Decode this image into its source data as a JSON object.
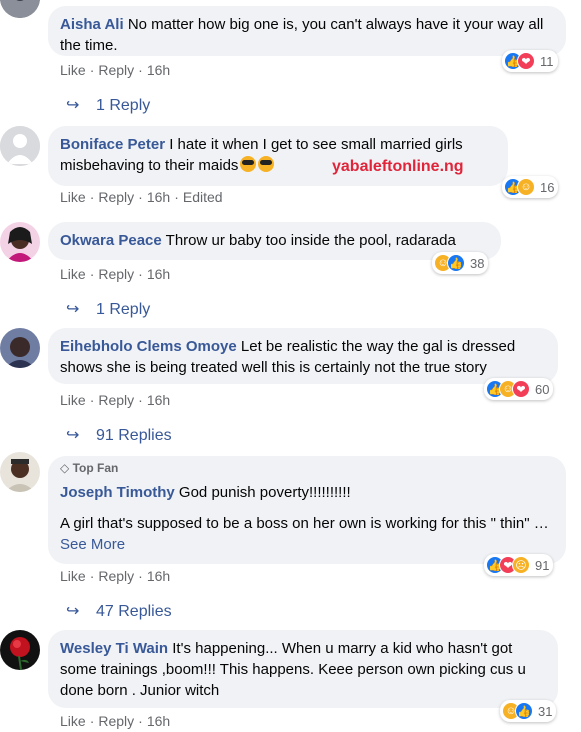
{
  "watermark": "yabaleftonline.ng",
  "comments": [
    {
      "author": "Aisha Ali",
      "text": "No matter how big one is, you can't always have it your way all the time.",
      "actions": {
        "like": "Like",
        "reply": "Reply",
        "time": "16h"
      },
      "reaction_count": "11",
      "reaction_types": [
        "like",
        "love"
      ],
      "replies": "1 Reply"
    },
    {
      "author": "Boniface Peter",
      "text": "I hate it when I get to see small married girls misbehaving to their maids",
      "emoji": [
        "sunglasses-emoji",
        "sunglasses-emoji"
      ],
      "actions": {
        "like": "Like",
        "reply": "Reply",
        "time": "16h",
        "edited": "Edited"
      },
      "reaction_count": "16",
      "reaction_types": [
        "like",
        "haha"
      ]
    },
    {
      "author": "Okwara Peace",
      "text": "Throw ur baby too inside the pool, radarada",
      "actions": {
        "like": "Like",
        "reply": "Reply",
        "time": "16h"
      },
      "reaction_count": "38",
      "reaction_types": [
        "haha",
        "like"
      ],
      "replies": "1 Reply"
    },
    {
      "author": "Eihebholo Clems Omoye",
      "text": "Let be realistic the way the gal is dressed shows she is being treated well this is certainly not the true story",
      "actions": {
        "like": "Like",
        "reply": "Reply",
        "time": "16h"
      },
      "reaction_count": "60",
      "reaction_types": [
        "like",
        "haha",
        "love"
      ],
      "replies": "91 Replies"
    },
    {
      "badge": "Top Fan",
      "author": "Joseph Timothy",
      "text": "God punish poverty!!!!!!!!!!",
      "text2": "A girl that's supposed to be a boss on her own is working for this \" thin\" …",
      "see_more": "See More",
      "actions": {
        "like": "Like",
        "reply": "Reply",
        "time": "16h"
      },
      "reaction_count": "91",
      "reaction_types": [
        "like",
        "love",
        "sad"
      ],
      "replies": "47 Replies"
    },
    {
      "author": "Wesley Ti Wain",
      "text": "It's happening... When u marry a kid who hasn't got some trainings ,boom!!! This happens. Keee person own picking cus u done born . Junior witch",
      "actions": {
        "like": "Like",
        "reply": "Reply",
        "time": "16h"
      },
      "reaction_count": "31",
      "reaction_types": [
        "haha",
        "like"
      ]
    }
  ],
  "colors": {
    "name": "#385898",
    "bubble": "#f0f2f5",
    "meta": "#65676b",
    "watermark": "#e0253b"
  }
}
